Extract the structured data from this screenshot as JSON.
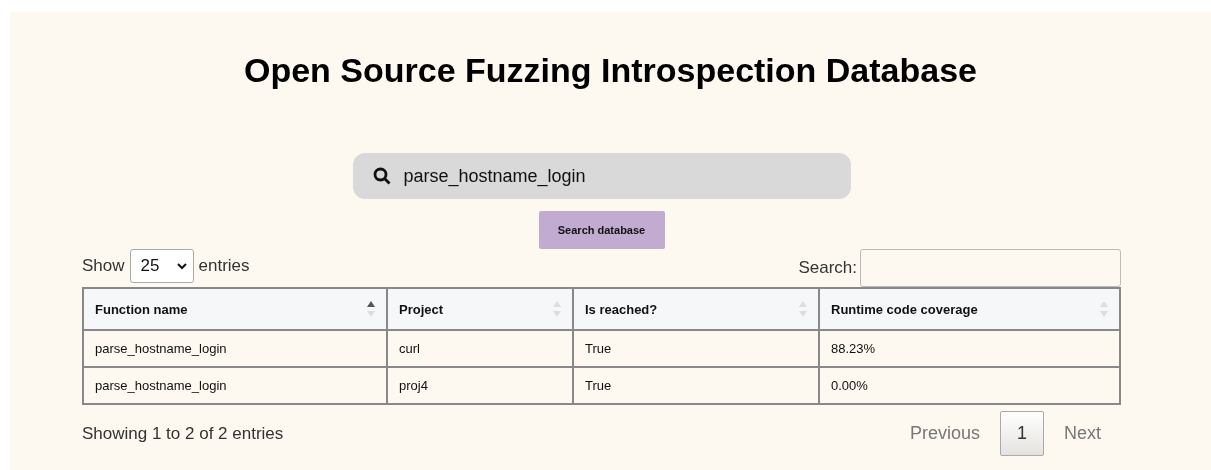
{
  "title": "Open Source Fuzzing Introspection Database",
  "search": {
    "value": "parse_hostname_login",
    "button": "Search database"
  },
  "length": {
    "before": "Show",
    "value": "25",
    "after": "entries"
  },
  "filter": {
    "label": "Search:"
  },
  "table": {
    "columns": [
      {
        "label": "Function name",
        "sorted_ascending": true
      },
      {
        "label": "Project",
        "sorted_ascending": false
      },
      {
        "label": "Is reached?",
        "sorted_ascending": false
      },
      {
        "label": "Runtime code coverage",
        "sorted_ascending": false
      }
    ],
    "rows": [
      [
        "parse_hostname_login",
        "curl",
        "True",
        "88.23%"
      ],
      [
        "parse_hostname_login",
        "proj4",
        "True",
        "0.00%"
      ]
    ]
  },
  "info": "Showing 1 to 2 of 2 entries",
  "pagination": {
    "previous": "Previous",
    "pages": [
      {
        "label": "1",
        "selected": true
      }
    ],
    "next": "Next"
  }
}
